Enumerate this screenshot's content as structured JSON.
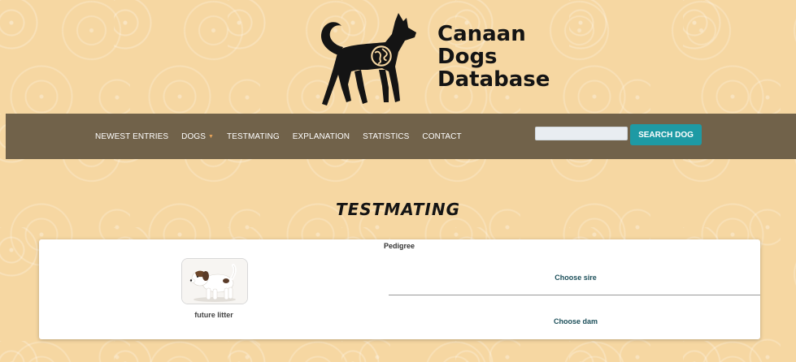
{
  "header": {
    "logo_lines": [
      "Canaan",
      "Dogs",
      "Database"
    ]
  },
  "nav": {
    "items": [
      {
        "label": "NEWEST ENTRIES"
      },
      {
        "label": "DOGS",
        "has_dropdown": true
      },
      {
        "label": "TESTMATING"
      },
      {
        "label": "EXPLANATION"
      },
      {
        "label": "STATISTICS"
      },
      {
        "label": "CONTACT"
      }
    ],
    "search": {
      "value": "",
      "placeholder": "",
      "button_label": "SEARCH DOG"
    }
  },
  "main": {
    "title": "TESTMATING",
    "card": {
      "pedigree_label": "Pedigree",
      "future_litter_label": "future litter",
      "choose_sire_label": "Choose sire",
      "choose_dam_label": "Choose dam"
    }
  },
  "colors": {
    "background": "#f6d7a2",
    "navbar": "#71624a",
    "accent": "#1e9aa4",
    "link": "#1c4f5a"
  },
  "icons": {
    "logo": "dog-silhouette-icon",
    "globe": "globe-icon",
    "dropdown": "caret-down-icon",
    "puppy": "puppy-image"
  }
}
